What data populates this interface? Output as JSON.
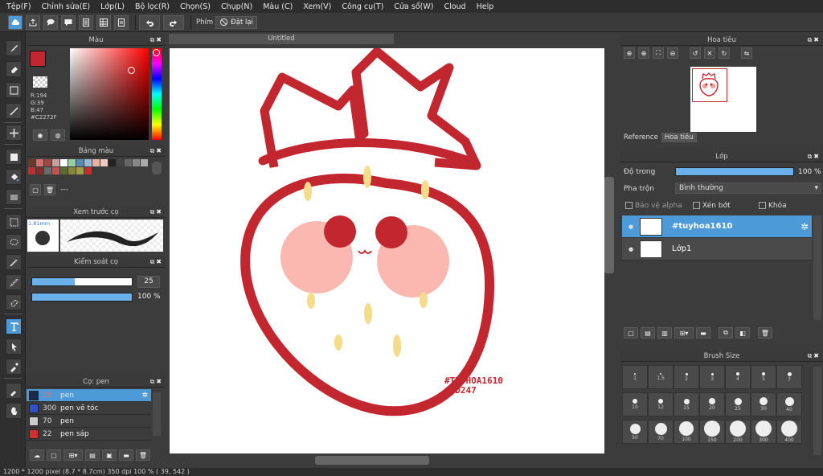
{
  "menu": [
    "Tệp(F)",
    "Chỉnh sửa(E)",
    "Lớp(L)",
    "Bộ lọc(R)",
    "Chọn(S)",
    "Chụp(N)",
    "Màu (C)",
    "Xem(V)",
    "Công cụ(T)",
    "Cửa sổ(W)",
    "Cloud",
    "Help"
  ],
  "toolbar": {
    "phim_label": "Phím",
    "reset_label": "Đặt lại"
  },
  "color_panel": {
    "title": "Màu",
    "r": "R:194",
    "g": "G:39",
    "b": "B:47",
    "hex": "#C2272F",
    "fg_color": "#C2272F"
  },
  "palette_panel": {
    "title": "Bảng màu",
    "dashes": "---",
    "swatches": [
      "#6b3a2e",
      "#d86b6b",
      "#a04848",
      "#c8a0a0",
      "#ffffff",
      "#9ad0a0",
      "#5a8ab8",
      "#9ab8d8",
      "#e8b0a0",
      "#f0c8c0",
      "#222222",
      "#444444",
      "#666666",
      "#888888",
      "#aaaaaa",
      "#b83030",
      "#8a2a2a",
      "#6a6a6a",
      "#c85050",
      "#5a6a30",
      "#888830",
      "#a0a040",
      "#cc2a2a"
    ]
  },
  "brush_preview": {
    "title": "Xem trước cọ",
    "size": "1.81mm"
  },
  "brush_control": {
    "title": "Kiểm soát cọ",
    "size_value": "25",
    "opacity_value": "100 %",
    "size_pct": 0.43,
    "opacity_pct": 1.0
  },
  "brush_list": {
    "title": "Cọ: pen",
    "items": [
      {
        "size": "25",
        "name": "pen",
        "color": "#1a2a4a"
      },
      {
        "size": "300",
        "name": "pen vẽ tóc",
        "color": "#3050d0"
      },
      {
        "size": "70",
        "name": "pen",
        "color": "#cccccc"
      },
      {
        "size": "22",
        "name": "pen sáp",
        "color": "#d03030"
      }
    ]
  },
  "canvas": {
    "tab_title": "Untitled",
    "watermark_line1": "#TUYHOA1610",
    "watermark_line2": "#HD247"
  },
  "navigator": {
    "title": "Hoa tiêu",
    "tab_reference": "Reference",
    "tab_navigator": "Hoa tiêu"
  },
  "layer_panel": {
    "title": "Lớp",
    "opacity_label": "Độ trong",
    "opacity_value": "100 %",
    "opacity_pct": 1.0,
    "blend_label": "Pha trộn",
    "blend_value": "Bình thường",
    "protect_alpha": "Bảo vệ alpha",
    "clipping": "Xén bớt",
    "lock": "Khóa",
    "layers": [
      {
        "name": "#tuyhoa1610",
        "selected": true
      },
      {
        "name": "Lớp1",
        "selected": false
      }
    ]
  },
  "brush_size": {
    "title": "Brush Size",
    "sizes": [
      "1",
      "1.5",
      "2",
      "3",
      "4",
      "5",
      "7",
      "10",
      "12",
      "15",
      "20",
      "25",
      "30",
      "40",
      "50",
      "70",
      "100",
      "150",
      "200",
      "300",
      "400"
    ]
  },
  "status": {
    "text": "1200 * 1200 pixel   (8.7 * 8.7cm)   350 dpi   100 %   ( 39, 542 )"
  }
}
